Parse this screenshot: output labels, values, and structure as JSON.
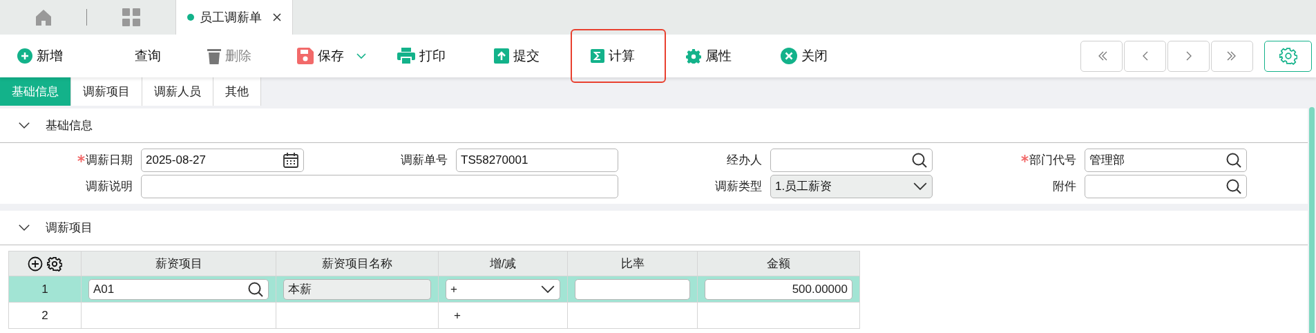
{
  "tab_bar": {
    "tabs": [
      {
        "label": "员工调薪单",
        "selected": true
      }
    ]
  },
  "toolbar": {
    "buttons": [
      {
        "label": "新增",
        "kind": "plus",
        "disabled": false,
        "highlighted": false,
        "has_dropdown": false
      },
      {
        "label": "查询",
        "kind": "none",
        "disabled": false,
        "highlighted": false,
        "has_dropdown": false
      },
      {
        "label": "删除",
        "kind": "trash",
        "disabled": true,
        "highlighted": false,
        "has_dropdown": false
      },
      {
        "label": "保存",
        "kind": "save",
        "disabled": false,
        "highlighted": false,
        "has_dropdown": true
      },
      {
        "label": "打印",
        "kind": "print",
        "disabled": false,
        "highlighted": false,
        "has_dropdown": false
      },
      {
        "label": "提交",
        "kind": "submit",
        "disabled": false,
        "highlighted": false,
        "has_dropdown": false
      },
      {
        "label": "计算",
        "kind": "sigma",
        "disabled": false,
        "highlighted": true,
        "has_dropdown": false
      },
      {
        "label": "属性",
        "kind": "gear",
        "disabled": false,
        "highlighted": false,
        "has_dropdown": false
      },
      {
        "label": "关闭",
        "kind": "close",
        "disabled": false,
        "highlighted": false,
        "has_dropdown": false
      }
    ]
  },
  "section_tabs": [
    {
      "label": "基础信息",
      "selected": true
    },
    {
      "label": "调薪项目",
      "selected": false
    },
    {
      "label": "调薪人员",
      "selected": false
    },
    {
      "label": "其他",
      "selected": false
    }
  ],
  "basic_section": {
    "title": "基础信息",
    "expanded": true,
    "fields": [
      {
        "label": "调薪日期",
        "required": true,
        "kind": "date",
        "value": "2025-08-27",
        "wide": false
      },
      {
        "label": "调薪单号",
        "required": false,
        "kind": "text",
        "value": "TS58270001",
        "wide": false
      },
      {
        "label": "经办人",
        "required": false,
        "kind": "lookup",
        "wide": false
      },
      {
        "label": "部门代号",
        "required": true,
        "kind": "lookup",
        "value": "管理部",
        "wide": false
      },
      {
        "label": "调薪说明",
        "required": false,
        "kind": "text",
        "wide": true
      },
      {
        "label": "调薪类型",
        "required": false,
        "kind": "select",
        "value": "1.员工薪资",
        "wide": false
      },
      {
        "label": "附件",
        "required": false,
        "kind": "lookup",
        "wide": false
      }
    ]
  },
  "items_section": {
    "title": "调薪项目",
    "expanded": true,
    "columns": [
      "薪资项目",
      "薪资项目名称",
      "增/减",
      "比率",
      "金额"
    ],
    "rows": [
      {
        "number": "1",
        "selected": true,
        "cells": [
          {
            "kind": "lookup",
            "value": "A01"
          },
          {
            "kind": "readonly",
            "value": "本薪"
          },
          {
            "kind": "select",
            "value": "+"
          },
          {
            "kind": "input"
          },
          {
            "kind": "number",
            "value": "500.00000"
          }
        ]
      },
      {
        "number": "2",
        "selected": false,
        "cells": [
          {
            "kind": "blank"
          },
          {
            "kind": "blank"
          },
          {
            "kind": "text",
            "value": "+"
          },
          {
            "kind": "blank"
          },
          {
            "kind": "blank"
          }
        ]
      }
    ]
  }
}
